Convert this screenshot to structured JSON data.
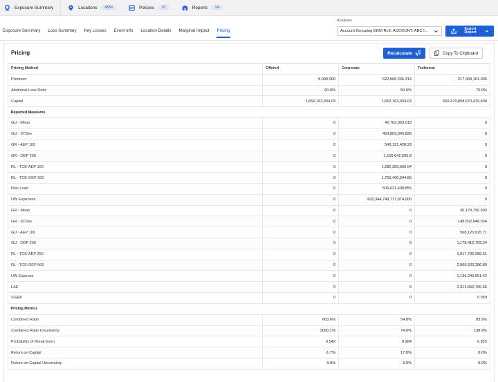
{
  "topbar": {
    "items": [
      {
        "label": "Exposure Summary",
        "badge": null
      },
      {
        "label": "Locations",
        "badge": "4556"
      },
      {
        "label": "Policies",
        "badge": "37"
      },
      {
        "label": "Reports",
        "badge": "54"
      }
    ]
  },
  "subnav": {
    "tabs": [
      "Exposure Summary",
      "Loss Summary",
      "Key Losses",
      "Event Info",
      "Location Details",
      "Marginal Impact",
      "Pricing"
    ],
    "active": "Pricing"
  },
  "analyses": {
    "label": "Analyses",
    "selected": "Account Grouping EDM Rv3: ACCOUNT: ABC I..."
  },
  "export": {
    "label": "Export Report"
  },
  "panel": {
    "title": "Pricing",
    "recalculate_label": "Recalculate",
    "copy_label": "Copy To Clipboard"
  },
  "table": {
    "headers": [
      "Pricing Method",
      "Offered",
      "Corporate",
      "Technical"
    ],
    "rows": [
      {
        "type": "data",
        "cells": [
          "Premium",
          "5,000,000",
          "622,566,245.314",
          "217,058,101.035"
        ]
      },
      {
        "type": "data",
        "cells": [
          "Attritional Loss Ratio",
          "60.0%",
          "50.0%",
          "70.0%"
        ]
      },
      {
        "type": "data",
        "cells": [
          "Capital",
          "1,652,163,934.03",
          "1,652,163,934.03",
          "669,479,858,670,419,600"
        ]
      },
      {
        "type": "section",
        "cells": [
          "Reported Measures"
        ]
      },
      {
        "type": "data",
        "cells": [
          "GU - Mean",
          "0",
          "42,762,063.019",
          "0"
        ]
      },
      {
        "type": "data",
        "cells": [
          "GU - STDev",
          "0",
          "463,809,345.836",
          "0"
        ]
      },
      {
        "type": "data",
        "cells": [
          "GR - AEP 100",
          "0",
          "543,121,428.23",
          "0"
        ]
      },
      {
        "type": "data",
        "cells": [
          "GR - OEP 200",
          "0",
          "1,109,042,505.8",
          "0"
        ]
      },
      {
        "type": "data",
        "cells": [
          "RL - TCE-AEP 100",
          "0",
          "1,282,355,566.04",
          "0"
        ]
      },
      {
        "type": "data",
        "cells": [
          "RL - TCE-OEP 200",
          "0",
          "1,763,490,344.66",
          "0"
        ]
      },
      {
        "type": "data",
        "cells": [
          "Risk Load",
          "0",
          "506,621,408.855",
          "0"
        ]
      },
      {
        "type": "data",
        "cells": [
          "UW Expenses",
          "0",
          "602,344,749,717,874,000",
          "0"
        ]
      },
      {
        "type": "data",
        "cells": [
          "GR - Mean",
          "0",
          "0",
          "30,179,790.993"
        ]
      },
      {
        "type": "data",
        "cells": [
          "GR - STDev",
          "0",
          "0",
          "149,502,648.034"
        ]
      },
      {
        "type": "data",
        "cells": [
          "GU - AEP 100",
          "0",
          "0",
          "568,120,025.71"
        ]
      },
      {
        "type": "data",
        "cells": [
          "GU - OEP 200",
          "0",
          "0",
          "1,178,412,709.24"
        ]
      },
      {
        "type": "data",
        "cells": [
          "RL - TCE-AEP 250",
          "0",
          "0",
          "1,917,736,285.51"
        ]
      },
      {
        "type": "data",
        "cells": [
          "RL - TCE-OEP 500",
          "0",
          "0",
          "2,005,520,286.89"
        ]
      },
      {
        "type": "data",
        "cells": [
          "UW Expense",
          "0",
          "0",
          "1,136,240,051.42"
        ]
      },
      {
        "type": "data",
        "cells": [
          "LAE",
          "0",
          "0",
          "2,314,652,760.66"
        ]
      },
      {
        "type": "data",
        "cells": [
          "SG&A",
          "0",
          "0",
          "0.959"
        ]
      },
      {
        "type": "section",
        "cells": [
          "Pricing Metrics"
        ]
      },
      {
        "type": "data",
        "cells": [
          "Combined Ratio",
          "663.6%",
          "54.8%",
          "83.9%"
        ]
      },
      {
        "type": "data",
        "cells": [
          "Combined Ratio Uncertainty",
          "3050.1%",
          "74.0%",
          "138.9%"
        ]
      },
      {
        "type": "data",
        "cells": [
          "Probability of Break Even",
          "0.542",
          "0.984",
          "0.925"
        ]
      },
      {
        "type": "data",
        "cells": [
          "Return on Capital",
          "-1.7%",
          "17.0%",
          "0.0%"
        ]
      },
      {
        "type": "data",
        "cells": [
          "Return on Capital Uncertainty",
          "9.0%",
          "9.0%",
          "0.0%"
        ]
      }
    ]
  }
}
